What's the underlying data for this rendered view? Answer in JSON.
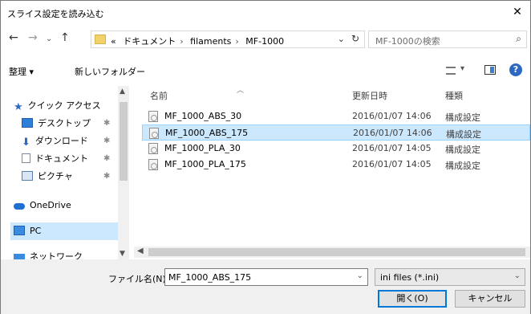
{
  "window": {
    "title": "スライス設定を読み込む"
  },
  "nav": {
    "crumbs": [
      "«",
      "ドキュメント",
      "filaments",
      "MF-1000"
    ],
    "search_placeholder": "MF-1000の検索"
  },
  "toolbar": {
    "organize": "整理 ▾",
    "new_folder": "新しいフォルダー"
  },
  "sidebar": {
    "items": [
      {
        "label": "クイック アクセス",
        "icon": "star-icon"
      },
      {
        "label": "デスクトップ",
        "icon": "desktop-icon",
        "pin": "✱"
      },
      {
        "label": "ダウンロード",
        "icon": "download-icon",
        "pin": "✱"
      },
      {
        "label": "ドキュメント",
        "icon": "document-icon",
        "pin": "✱"
      },
      {
        "label": "ピクチャ",
        "icon": "pictures-icon",
        "pin": "✱"
      },
      {
        "label": "OneDrive",
        "icon": "cloud-icon"
      },
      {
        "label": "PC",
        "icon": "pc-icon"
      },
      {
        "label": "ネットワーク",
        "icon": "network-icon"
      }
    ]
  },
  "files": {
    "columns": {
      "name": "名前",
      "date": "更新日時",
      "type": "種類"
    },
    "rows": [
      {
        "name": "MF_1000_ABS_30",
        "date": "2016/01/07 14:06",
        "type": "構成設定"
      },
      {
        "name": "MF_1000_ABS_175",
        "date": "2016/01/07 14:06",
        "type": "構成設定",
        "selected": true
      },
      {
        "name": "MF_1000_PLA_30",
        "date": "2016/01/07 14:05",
        "type": "構成設定"
      },
      {
        "name": "MF_1000_PLA_175",
        "date": "2016/01/07 14:05",
        "type": "構成設定"
      }
    ]
  },
  "bottom": {
    "filename_label": "ファイル名(N):",
    "filename_value": "MF_1000_ABS_175",
    "filetype": "ini files (*.ini)",
    "open_label": "開く(O)",
    "cancel_label": "キャンセル"
  },
  "colors": {
    "accent": "#0078d7",
    "selection": "#cce8ff"
  }
}
